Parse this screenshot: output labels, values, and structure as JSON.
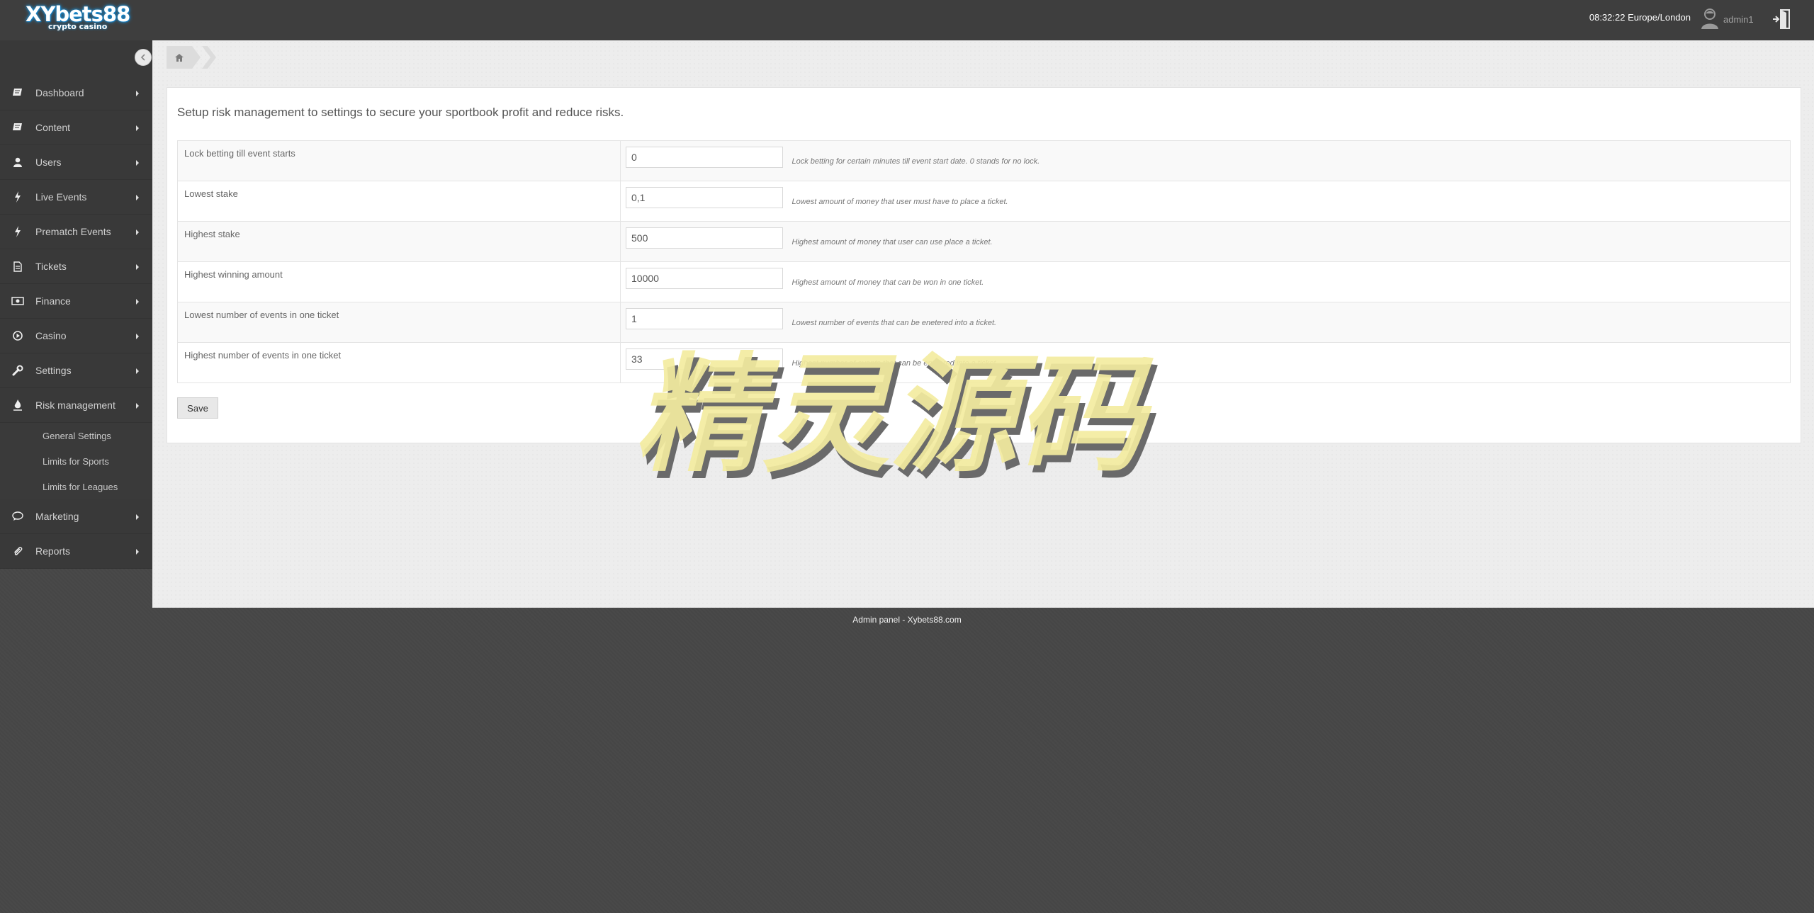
{
  "header": {
    "logo_main": "XYbets88",
    "logo_sub": "crypto casino",
    "clock": "08:32:22 Europe/London",
    "username": "admin1",
    "icons": {
      "user": "user-avatar-icon",
      "logout": "logout-icon"
    }
  },
  "sidebar": {
    "items": [
      {
        "label": "Dashboard",
        "icon": "book-icon"
      },
      {
        "label": "Content",
        "icon": "book-icon"
      },
      {
        "label": "Users",
        "icon": "user-icon"
      },
      {
        "label": "Live Events",
        "icon": "bolt-icon"
      },
      {
        "label": "Prematch Events",
        "icon": "bolt-icon"
      },
      {
        "label": "Tickets",
        "icon": "document-icon"
      },
      {
        "label": "Finance",
        "icon": "money-icon"
      },
      {
        "label": "Casino",
        "icon": "play-circle-icon"
      },
      {
        "label": "Settings",
        "icon": "wrench-icon"
      },
      {
        "label": "Risk management",
        "icon": "fire-icon"
      },
      {
        "label": "Marketing",
        "icon": "chat-bubble-icon"
      },
      {
        "label": "Reports",
        "icon": "paperclip-icon"
      }
    ],
    "submenu": [
      {
        "label": "General Settings"
      },
      {
        "label": "Limits for Sports"
      },
      {
        "label": "Limits for Leagues"
      }
    ]
  },
  "main": {
    "intro": "Setup risk management to settings to secure your sportbook profit and reduce risks.",
    "rows": [
      {
        "label": "Lock betting till event starts",
        "value": "0",
        "hint": "Lock betting for certain minutes till event start date. 0 stands for no lock."
      },
      {
        "label": "Lowest stake",
        "value": "0,1",
        "hint": "Lowest amount of money that user must have to place a ticket."
      },
      {
        "label": "Highest stake",
        "value": "500",
        "hint": "Highest amount of money that user can use place a ticket."
      },
      {
        "label": "Highest winning amount",
        "value": "10000",
        "hint": "Highest amount of money that can be won in one ticket."
      },
      {
        "label": "Lowest number of events in one ticket",
        "value": "1",
        "hint": "Lowest number of events that can be enetered into a ticket."
      },
      {
        "label": "Highest number of events in one ticket",
        "value": "33",
        "hint": "Highest number of events that can be enetered into a ticket."
      }
    ],
    "save_label": "Save"
  },
  "footer": {
    "text": "Admin panel - Xybets88.com"
  },
  "watermark": {
    "text": "精灵源码"
  },
  "colors": {
    "sidebar_bg": "#393939",
    "header_bg": "#3e3e3e",
    "logo_glow": "#1a8fd6",
    "watermark_fill": "#f3eca0"
  }
}
